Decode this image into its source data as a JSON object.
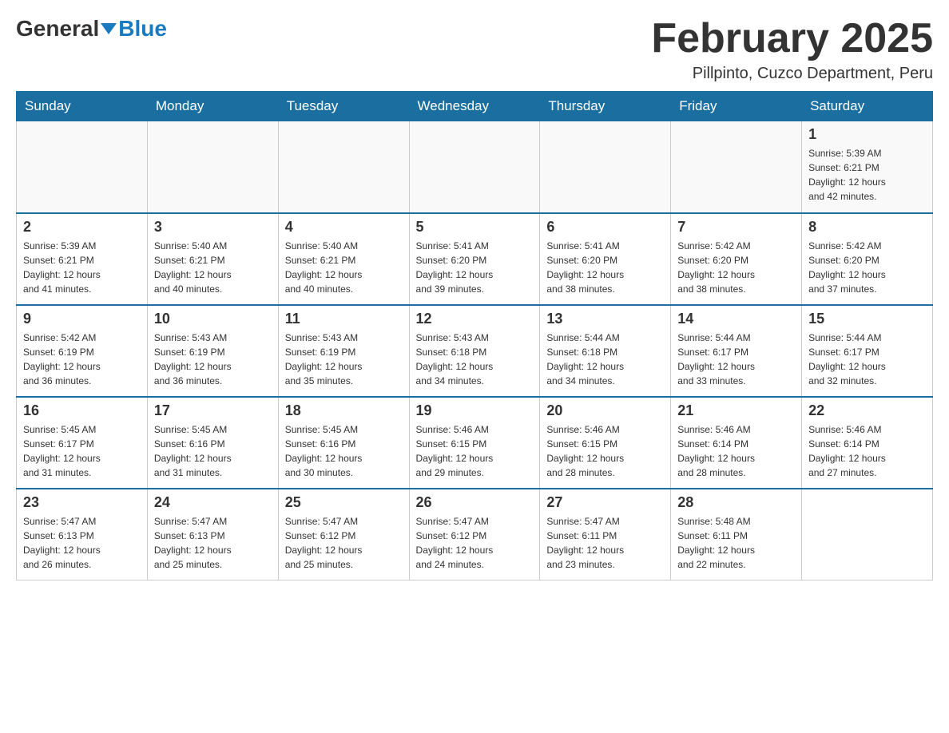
{
  "header": {
    "logo_general": "General",
    "logo_blue": "Blue",
    "title": "February 2025",
    "subtitle": "Pillpinto, Cuzco Department, Peru"
  },
  "days_of_week": [
    "Sunday",
    "Monday",
    "Tuesday",
    "Wednesday",
    "Thursday",
    "Friday",
    "Saturday"
  ],
  "weeks": [
    [
      {
        "day": "",
        "info": ""
      },
      {
        "day": "",
        "info": ""
      },
      {
        "day": "",
        "info": ""
      },
      {
        "day": "",
        "info": ""
      },
      {
        "day": "",
        "info": ""
      },
      {
        "day": "",
        "info": ""
      },
      {
        "day": "1",
        "info": "Sunrise: 5:39 AM\nSunset: 6:21 PM\nDaylight: 12 hours\nand 42 minutes."
      }
    ],
    [
      {
        "day": "2",
        "info": "Sunrise: 5:39 AM\nSunset: 6:21 PM\nDaylight: 12 hours\nand 41 minutes."
      },
      {
        "day": "3",
        "info": "Sunrise: 5:40 AM\nSunset: 6:21 PM\nDaylight: 12 hours\nand 40 minutes."
      },
      {
        "day": "4",
        "info": "Sunrise: 5:40 AM\nSunset: 6:21 PM\nDaylight: 12 hours\nand 40 minutes."
      },
      {
        "day": "5",
        "info": "Sunrise: 5:41 AM\nSunset: 6:20 PM\nDaylight: 12 hours\nand 39 minutes."
      },
      {
        "day": "6",
        "info": "Sunrise: 5:41 AM\nSunset: 6:20 PM\nDaylight: 12 hours\nand 38 minutes."
      },
      {
        "day": "7",
        "info": "Sunrise: 5:42 AM\nSunset: 6:20 PM\nDaylight: 12 hours\nand 38 minutes."
      },
      {
        "day": "8",
        "info": "Sunrise: 5:42 AM\nSunset: 6:20 PM\nDaylight: 12 hours\nand 37 minutes."
      }
    ],
    [
      {
        "day": "9",
        "info": "Sunrise: 5:42 AM\nSunset: 6:19 PM\nDaylight: 12 hours\nand 36 minutes."
      },
      {
        "day": "10",
        "info": "Sunrise: 5:43 AM\nSunset: 6:19 PM\nDaylight: 12 hours\nand 36 minutes."
      },
      {
        "day": "11",
        "info": "Sunrise: 5:43 AM\nSunset: 6:19 PM\nDaylight: 12 hours\nand 35 minutes."
      },
      {
        "day": "12",
        "info": "Sunrise: 5:43 AM\nSunset: 6:18 PM\nDaylight: 12 hours\nand 34 minutes."
      },
      {
        "day": "13",
        "info": "Sunrise: 5:44 AM\nSunset: 6:18 PM\nDaylight: 12 hours\nand 34 minutes."
      },
      {
        "day": "14",
        "info": "Sunrise: 5:44 AM\nSunset: 6:17 PM\nDaylight: 12 hours\nand 33 minutes."
      },
      {
        "day": "15",
        "info": "Sunrise: 5:44 AM\nSunset: 6:17 PM\nDaylight: 12 hours\nand 32 minutes."
      }
    ],
    [
      {
        "day": "16",
        "info": "Sunrise: 5:45 AM\nSunset: 6:17 PM\nDaylight: 12 hours\nand 31 minutes."
      },
      {
        "day": "17",
        "info": "Sunrise: 5:45 AM\nSunset: 6:16 PM\nDaylight: 12 hours\nand 31 minutes."
      },
      {
        "day": "18",
        "info": "Sunrise: 5:45 AM\nSunset: 6:16 PM\nDaylight: 12 hours\nand 30 minutes."
      },
      {
        "day": "19",
        "info": "Sunrise: 5:46 AM\nSunset: 6:15 PM\nDaylight: 12 hours\nand 29 minutes."
      },
      {
        "day": "20",
        "info": "Sunrise: 5:46 AM\nSunset: 6:15 PM\nDaylight: 12 hours\nand 28 minutes."
      },
      {
        "day": "21",
        "info": "Sunrise: 5:46 AM\nSunset: 6:14 PM\nDaylight: 12 hours\nand 28 minutes."
      },
      {
        "day": "22",
        "info": "Sunrise: 5:46 AM\nSunset: 6:14 PM\nDaylight: 12 hours\nand 27 minutes."
      }
    ],
    [
      {
        "day": "23",
        "info": "Sunrise: 5:47 AM\nSunset: 6:13 PM\nDaylight: 12 hours\nand 26 minutes."
      },
      {
        "day": "24",
        "info": "Sunrise: 5:47 AM\nSunset: 6:13 PM\nDaylight: 12 hours\nand 25 minutes."
      },
      {
        "day": "25",
        "info": "Sunrise: 5:47 AM\nSunset: 6:12 PM\nDaylight: 12 hours\nand 25 minutes."
      },
      {
        "day": "26",
        "info": "Sunrise: 5:47 AM\nSunset: 6:12 PM\nDaylight: 12 hours\nand 24 minutes."
      },
      {
        "day": "27",
        "info": "Sunrise: 5:47 AM\nSunset: 6:11 PM\nDaylight: 12 hours\nand 23 minutes."
      },
      {
        "day": "28",
        "info": "Sunrise: 5:48 AM\nSunset: 6:11 PM\nDaylight: 12 hours\nand 22 minutes."
      },
      {
        "day": "",
        "info": ""
      }
    ]
  ]
}
